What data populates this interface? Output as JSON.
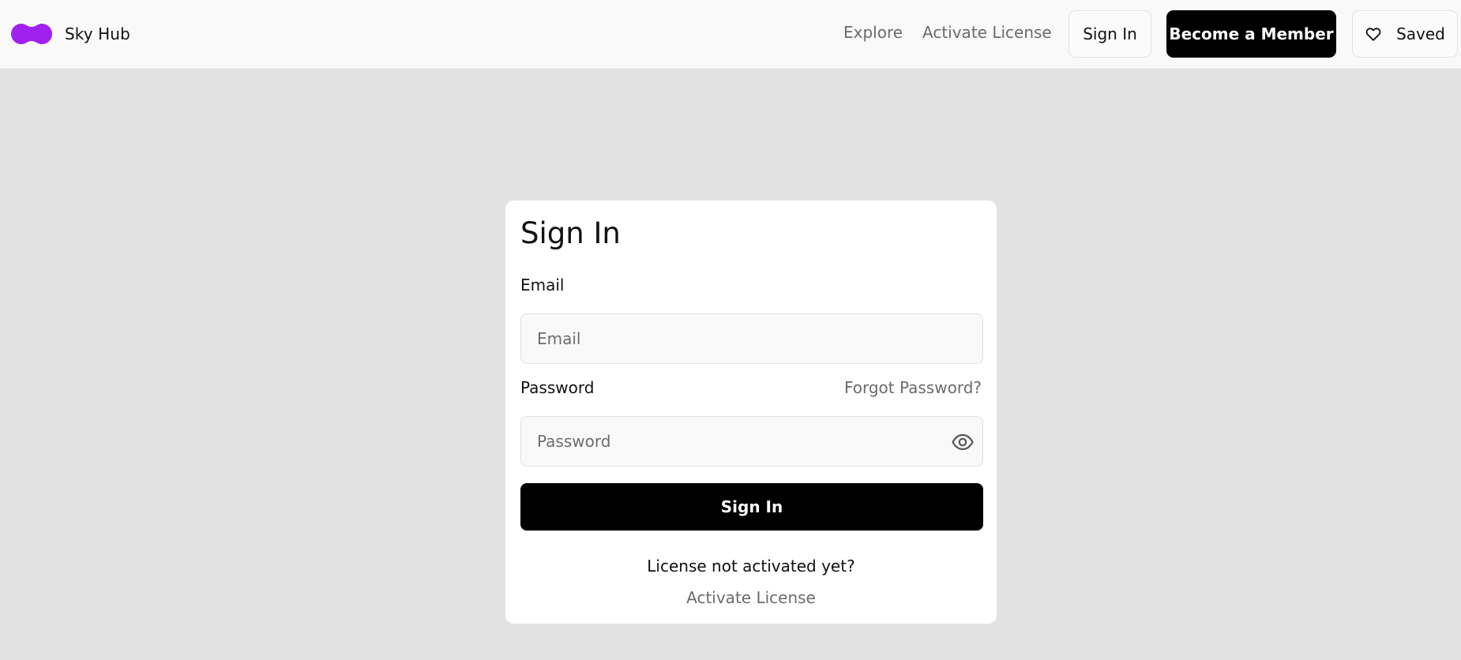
{
  "brand": {
    "name": "Sky Hub",
    "logo_icon": "brand-logo-icon",
    "logo_color": "#a020f0"
  },
  "nav": {
    "explore_label": "Explore",
    "activate_label": "Activate License",
    "signin_label": "Sign In",
    "member_label": "Become a Member",
    "saved_label": "Saved",
    "saved_icon": "heart-icon"
  },
  "form": {
    "title": "Sign In",
    "email_label": "Email",
    "email_placeholder": "Email",
    "email_value": "",
    "password_label": "Password",
    "forgot_label": "Forgot Password?",
    "password_placeholder": "Password",
    "password_value": "",
    "eye_icon": "eye-icon",
    "submit_label": "Sign In",
    "license_notice": "License not activated yet?",
    "activate_link": "Activate License"
  },
  "colors": {
    "page_bg": "#e2e2e2",
    "header_bg": "#f9f9f9",
    "primary_button": "#000000",
    "muted_text": "#6b6b6b"
  }
}
